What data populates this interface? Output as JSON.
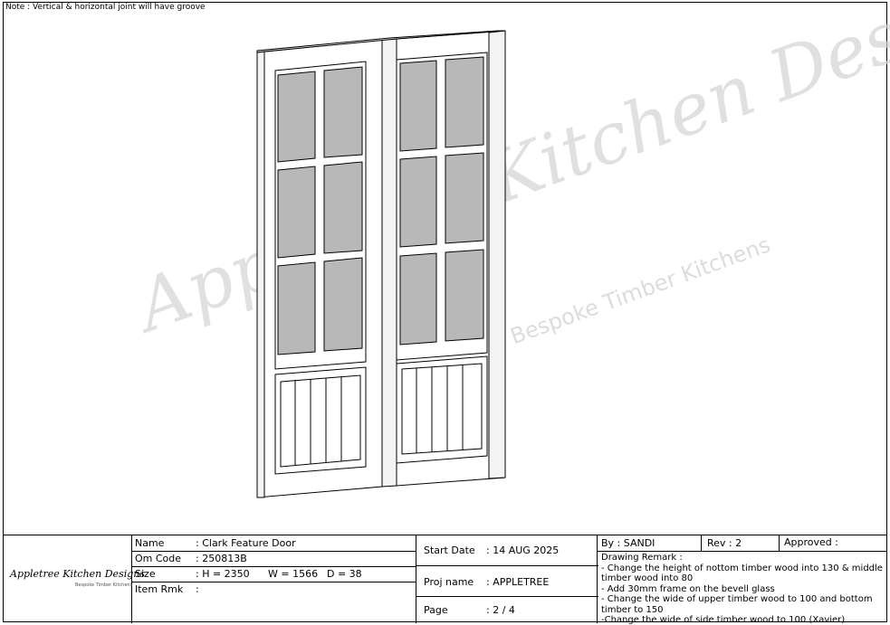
{
  "note": "Note : Vertical & horizontal joint will have groove",
  "watermark": {
    "main": "Appletree Kitchen Designs",
    "sub": "Bespoke Timber Kitchens"
  },
  "logo": {
    "main": "Appletree Kitchen Designs",
    "sub": "Bespoke Timber Kitchens"
  },
  "info": {
    "name_label": "Name",
    "name_value": ": Clark Feature Door",
    "om_label": "Om Code",
    "om_value": ": 250813B",
    "size_label": "Size",
    "size_h": ": H = 2350",
    "size_w": "W = 1566",
    "size_d": "D = 38",
    "rmk_label": "Item Rmk",
    "rmk_value": ":"
  },
  "mid": {
    "start_label": "Start Date",
    "start_value": ": 14 AUG 2025",
    "proj_label": "Proj name",
    "proj_value": ": APPLETREE",
    "page_label": "Page",
    "page_value": ": 2 / 4"
  },
  "right": {
    "by": "By  : SANDI",
    "rev": "Rev   :  2",
    "approved": "Approved  :",
    "remark_title": "Drawing Remark :",
    "remarks": [
      "- Change the height of nottom timber wood into 130 & middle timber wood into 80",
      "- Add 30mm frame on the bevell glass",
      "- Change the wide of upper timber wood to 100 and bottom timber to 150",
      "-Change the wide of side timber wood to 100 (Xavier)"
    ]
  }
}
